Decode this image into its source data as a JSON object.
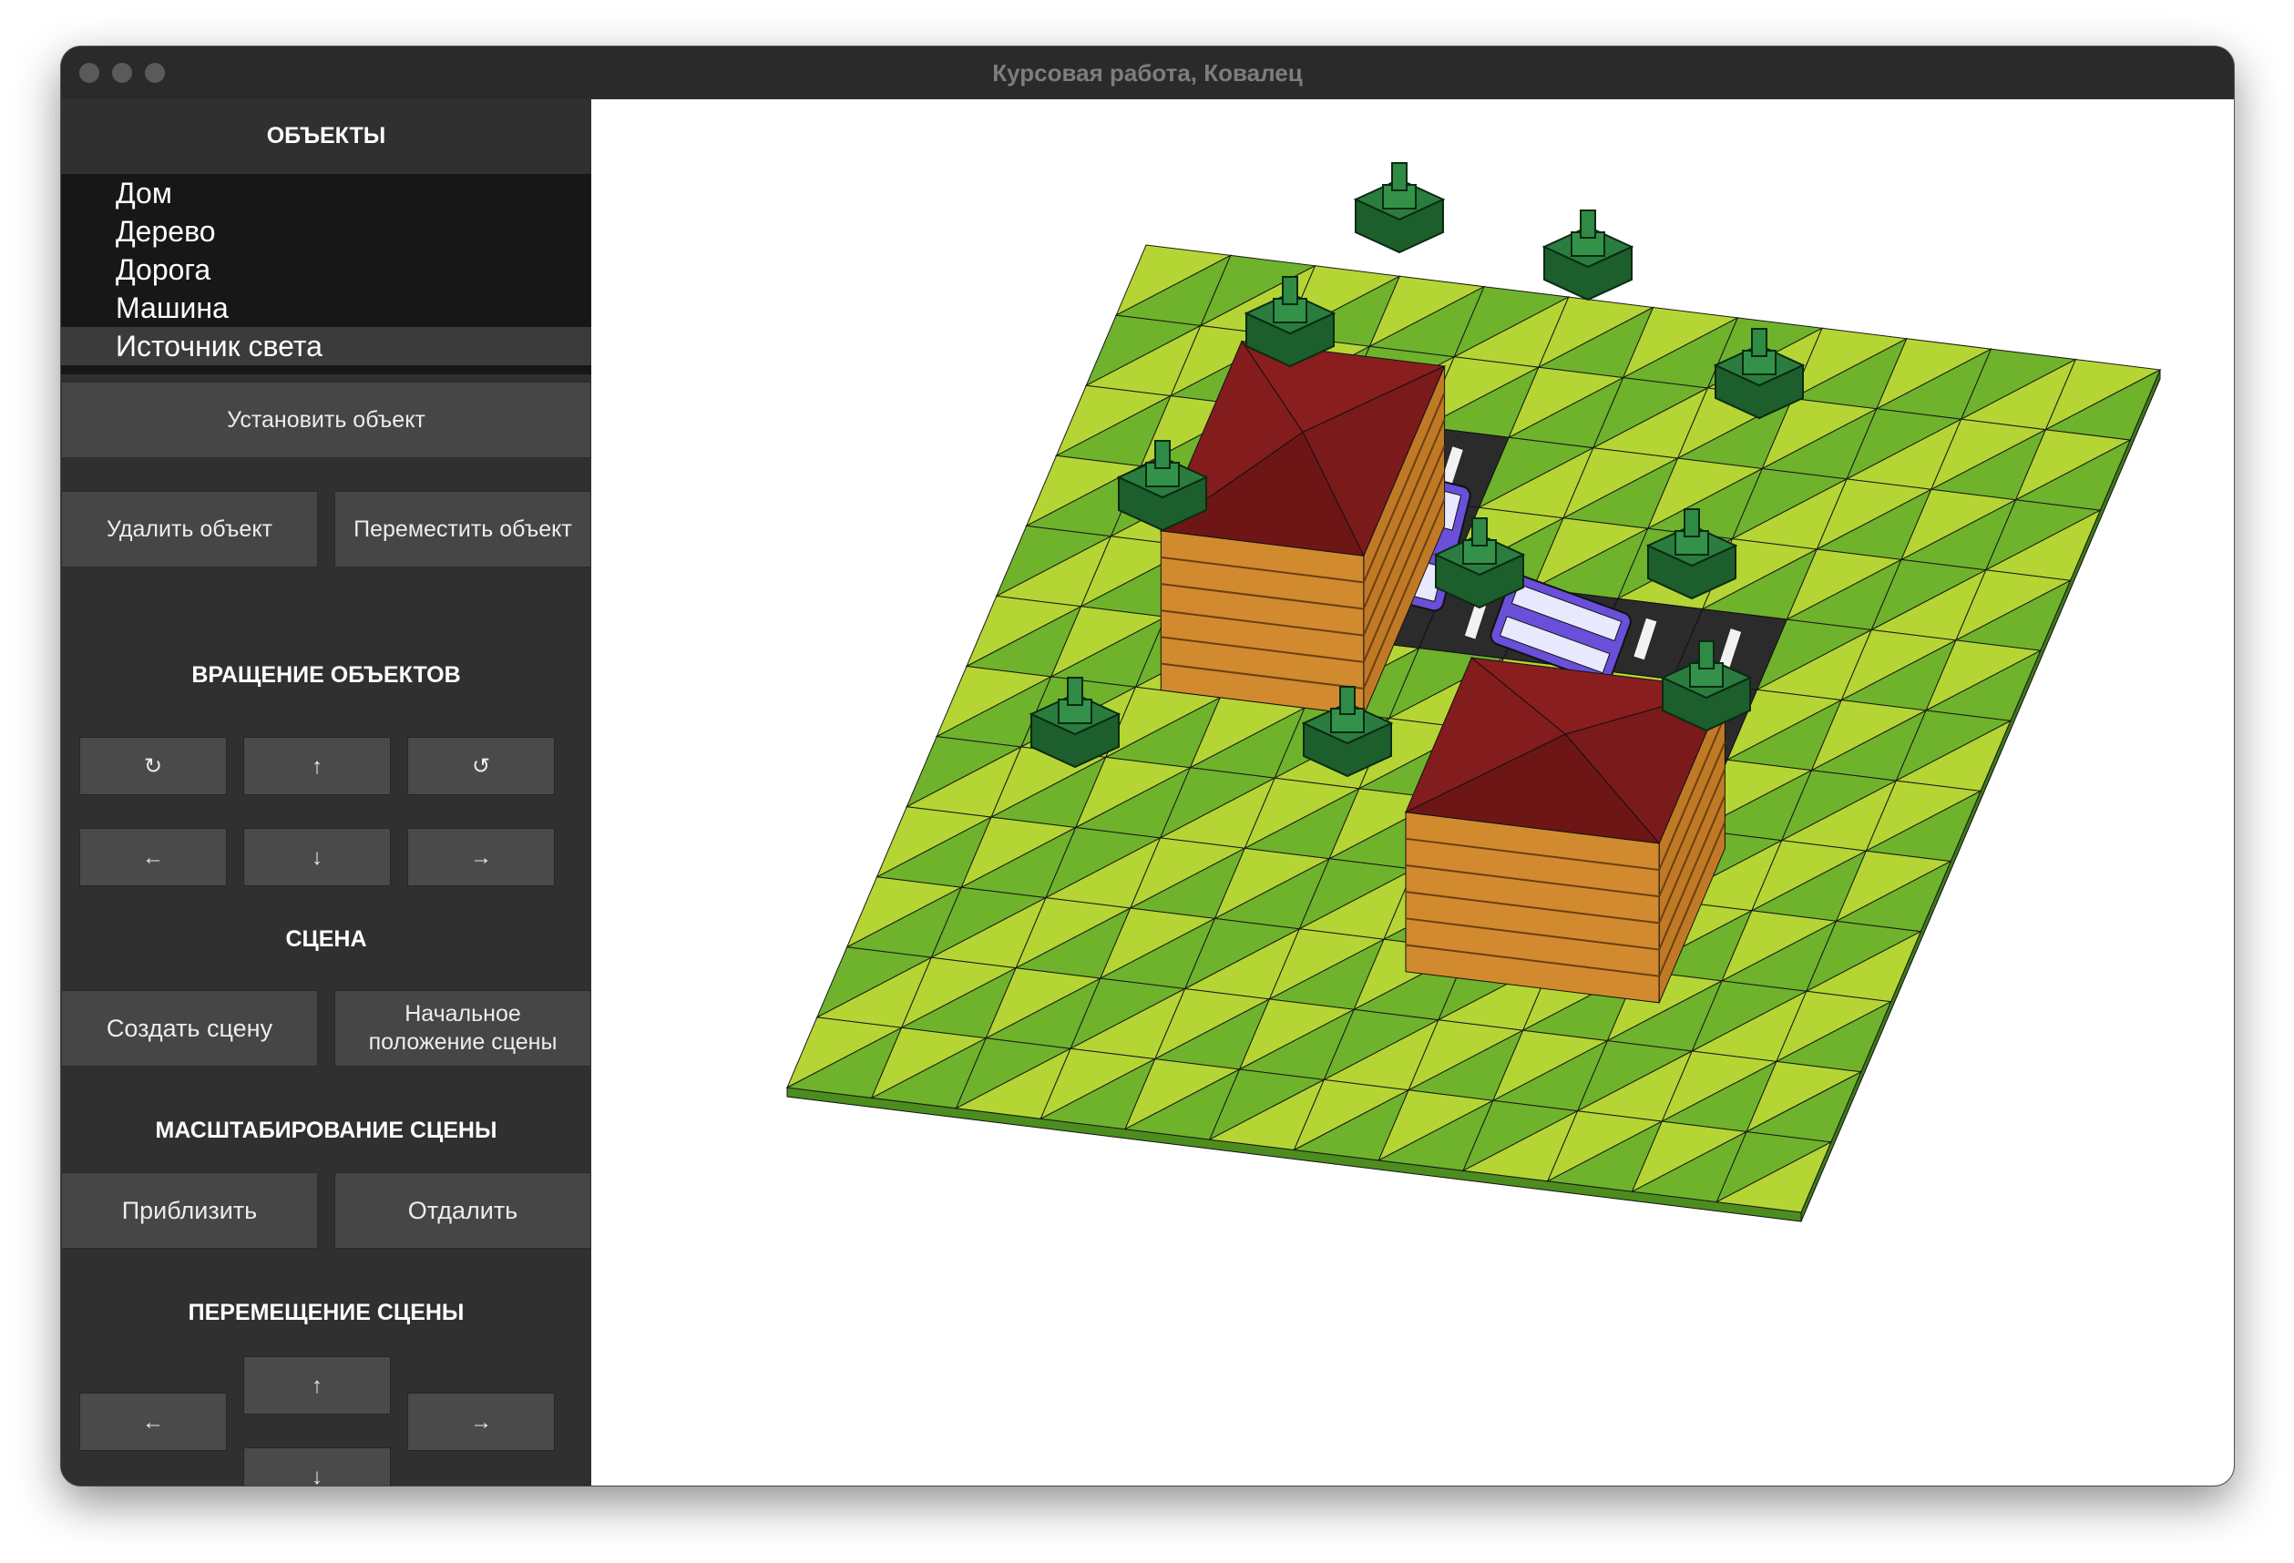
{
  "window": {
    "title": "Курсовая работа, Ковалец"
  },
  "sidebar": {
    "objects_header": "ОБЪЕКТЫ",
    "objects": [
      "Дом",
      "Дерево",
      "Дорога",
      "Машина",
      "Источник света"
    ],
    "selected_object": "Источник света",
    "buttons": {
      "place": "Установить объект",
      "delete": "Удалить объект",
      "move": "Переместить объект"
    },
    "rotation_header": "ВРАЩЕНИЕ ОБЪЕКТОВ",
    "rotation": {
      "rotate_cw": "↻",
      "up": "↑",
      "rotate_ccw": "↺",
      "left": "←",
      "down": "↓",
      "right": "→"
    },
    "scene_header": "СЦЕНА",
    "scene": {
      "create": "Создать сцену",
      "reset_line1": "Начальное",
      "reset_line2": "положение сцены"
    },
    "zoom_header": "МАСШТАБИРОВАНИЕ СЦЕНЫ",
    "zoom": {
      "zoom_in": "Приблизить",
      "zoom_out": "Отдалить"
    },
    "pan_header": "ПЕРЕМЕЩЕНИЕ СЦЕНЫ",
    "pan": {
      "up": "↑",
      "left": "←",
      "right": "→",
      "down": "↓"
    }
  },
  "scene_colors": {
    "grass_light": "#b5d534",
    "grass_dark": "#6fb22c",
    "road": "#2b2b2b",
    "roof": "#7a1a1a",
    "wall": "#d18a2e",
    "tree": "#2a7d3e",
    "car": "#6a4fd8"
  }
}
